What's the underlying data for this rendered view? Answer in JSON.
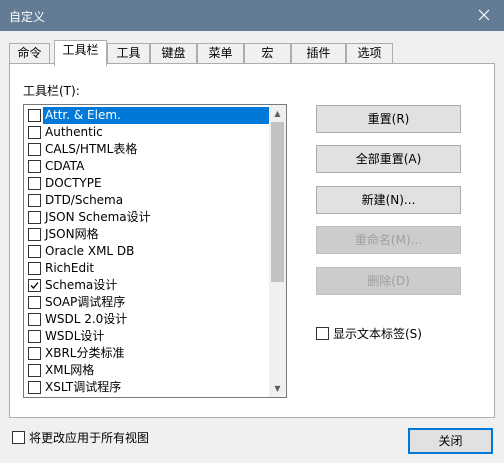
{
  "window": {
    "title": "自定义"
  },
  "tabs": [
    {
      "label": "命令"
    },
    {
      "label": "工具栏"
    },
    {
      "label": "工具"
    },
    {
      "label": "键盘"
    },
    {
      "label": "菜单"
    },
    {
      "label": "宏"
    },
    {
      "label": "插件"
    },
    {
      "label": "选项"
    }
  ],
  "toolbars": {
    "label": "工具栏(T):",
    "items": [
      {
        "label": "Attr. & Elem.",
        "checked": false,
        "selected": true
      },
      {
        "label": "Authentic",
        "checked": false
      },
      {
        "label": "CALS/HTML表格",
        "checked": false
      },
      {
        "label": "CDATA",
        "checked": false
      },
      {
        "label": "DOCTYPE",
        "checked": false
      },
      {
        "label": "DTD/Schema",
        "checked": false
      },
      {
        "label": "JSON Schema设计",
        "checked": false
      },
      {
        "label": "JSON网格",
        "checked": false
      },
      {
        "label": "Oracle XML DB",
        "checked": false
      },
      {
        "label": "RichEdit",
        "checked": false
      },
      {
        "label": "Schema设计",
        "checked": true
      },
      {
        "label": "SOAP调试程序",
        "checked": false
      },
      {
        "label": "WSDL 2.0设计",
        "checked": false
      },
      {
        "label": "WSDL设计",
        "checked": false
      },
      {
        "label": "XBRL分类标准",
        "checked": false
      },
      {
        "label": "XML网格",
        "checked": false
      },
      {
        "label": "XSLT调试程序",
        "checked": false
      }
    ]
  },
  "buttons": {
    "reset": "重置(R)",
    "reset_all": "全部重置(A)",
    "new": "新建(N)...",
    "rename": "重命名(M)...",
    "delete": "删除(D)"
  },
  "show_text_labels": {
    "label": "显示文本标签(S)",
    "checked": false
  },
  "apply_all_views": {
    "label": "将更改应用于所有视图",
    "checked": false
  },
  "close_button": "关闭"
}
